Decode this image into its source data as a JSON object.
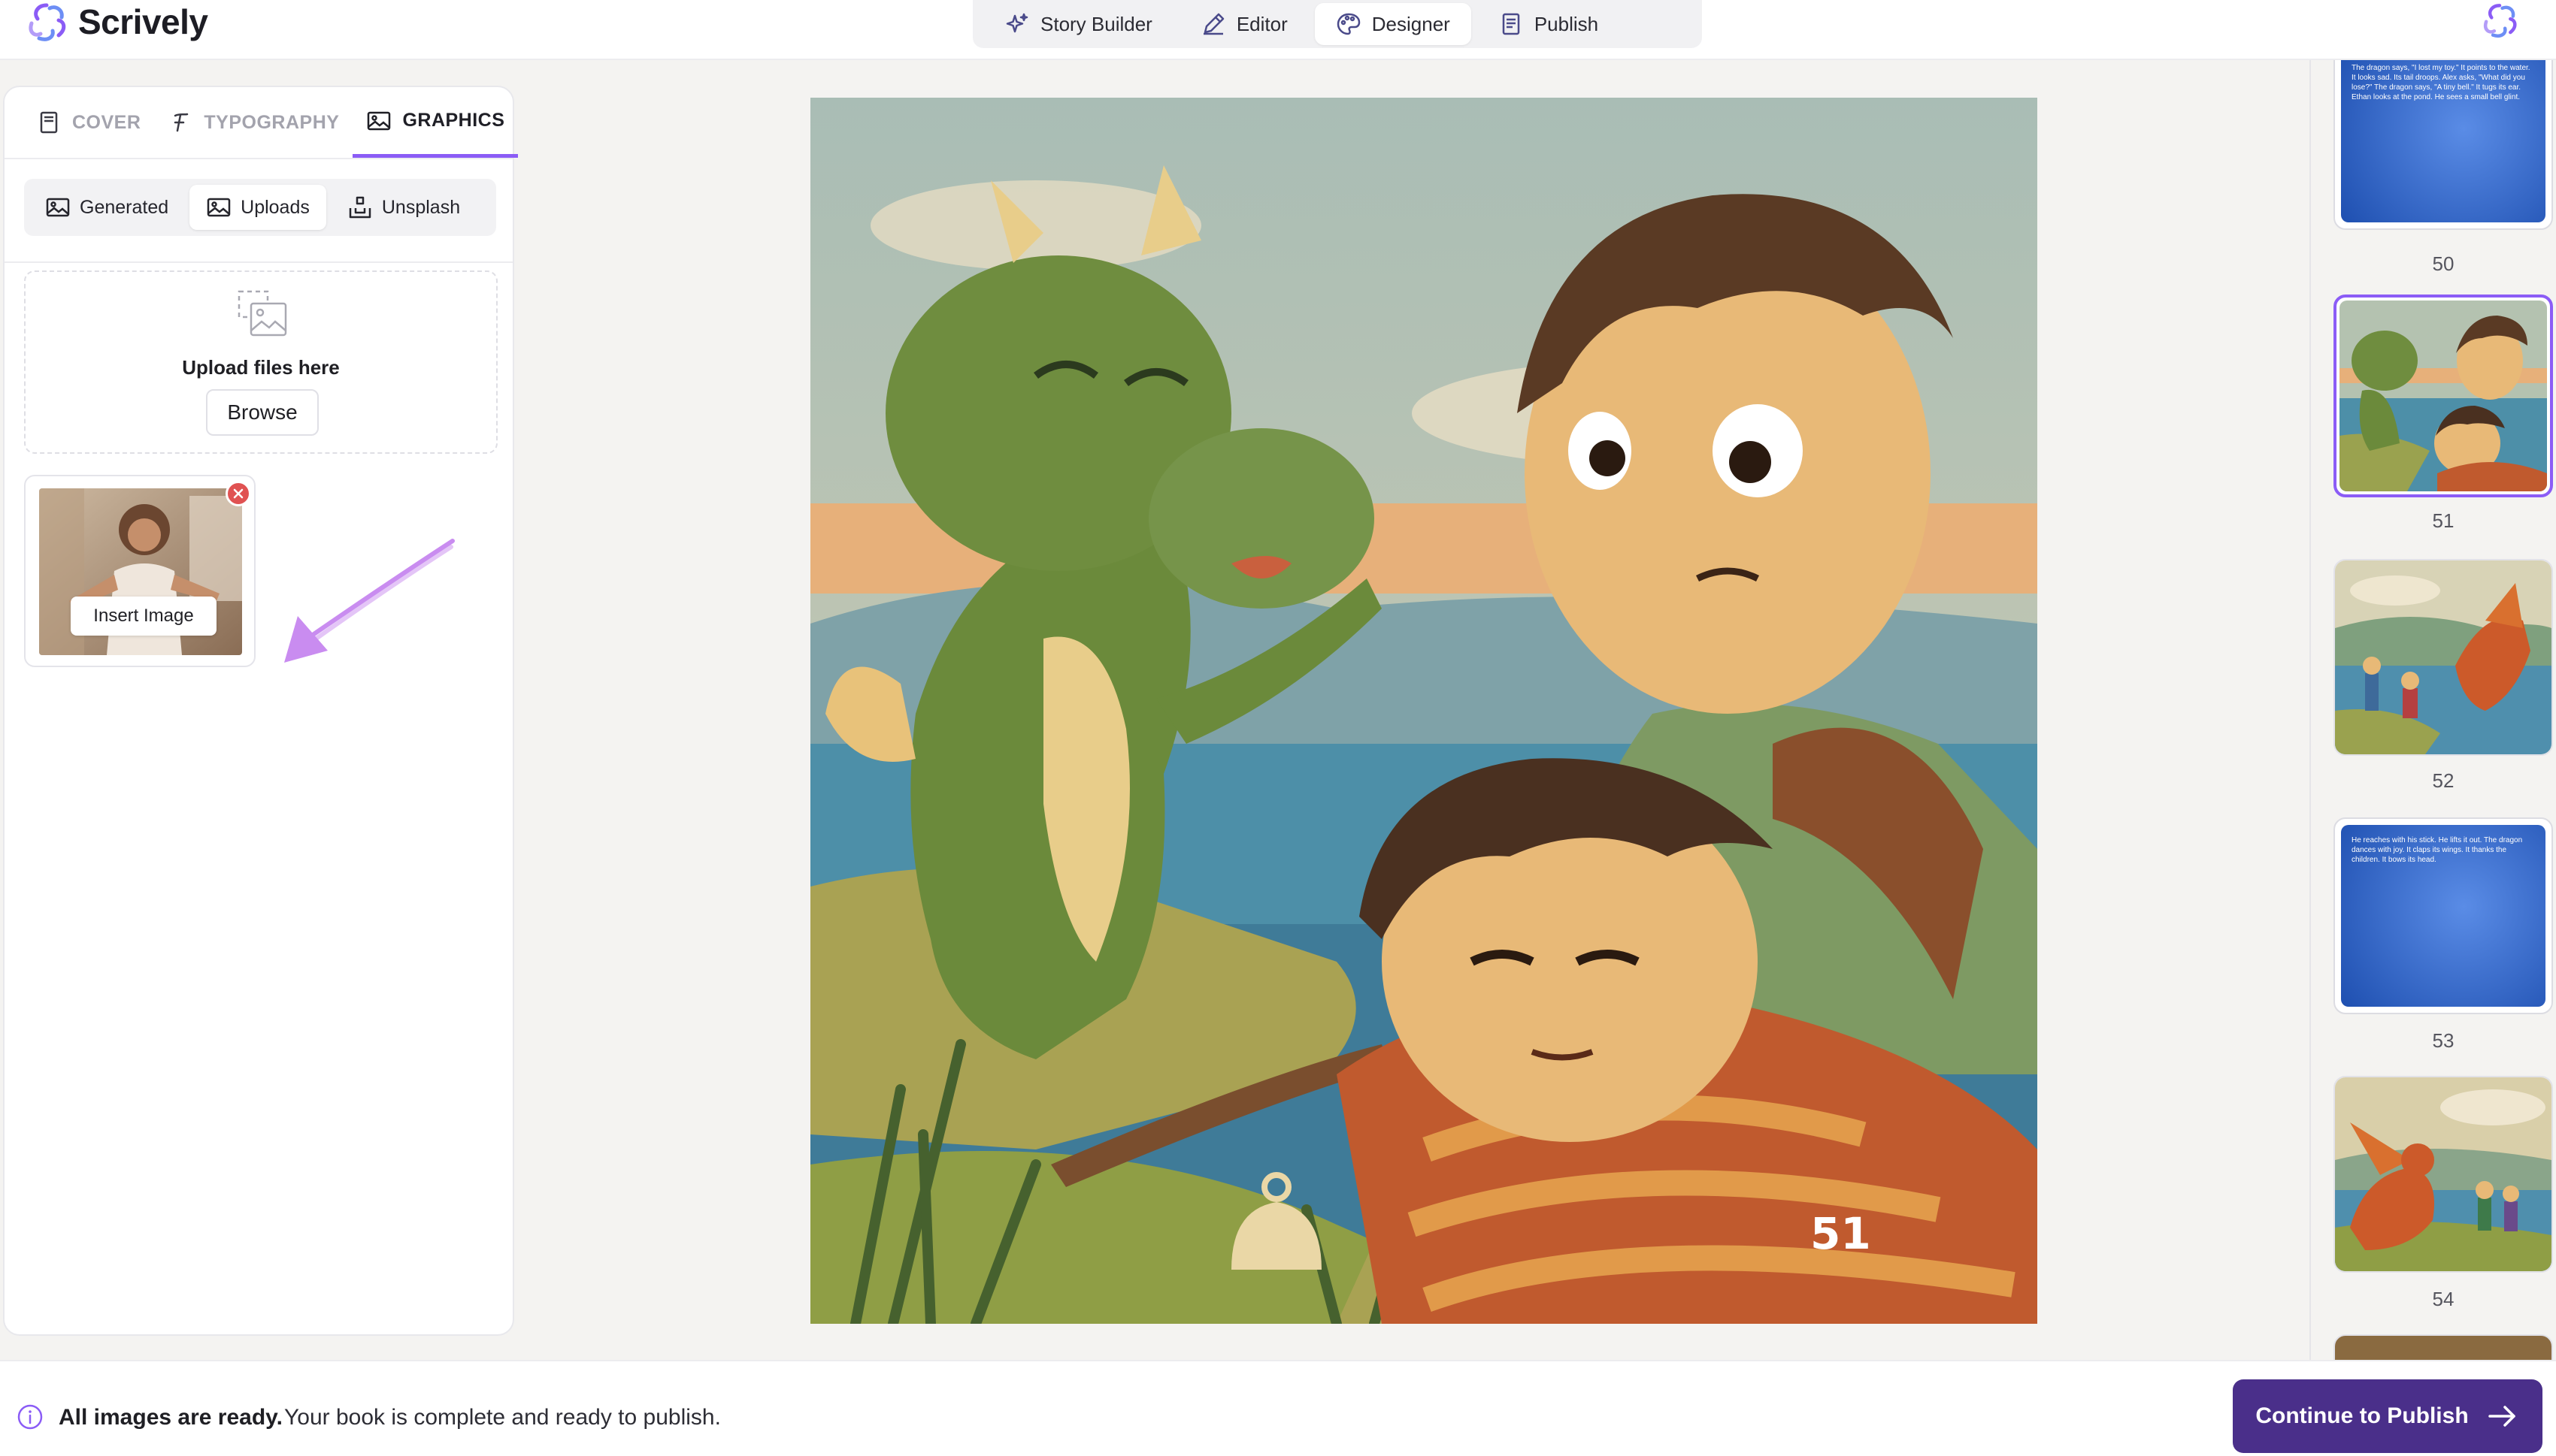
{
  "app": {
    "name": "Scrively",
    "brand_color": "#8b5cf6",
    "primary_button_color": "#4a2f8a"
  },
  "nav": {
    "items": [
      {
        "label": "Story Builder",
        "icon": "sparkles-icon",
        "active": false
      },
      {
        "label": "Editor",
        "icon": "pen-icon",
        "active": false
      },
      {
        "label": "Designer",
        "icon": "palette-icon",
        "active": true
      },
      {
        "label": "Publish",
        "icon": "document-icon",
        "active": false
      }
    ]
  },
  "left_panel": {
    "tabs": [
      {
        "label": "COVER",
        "icon": "book-icon",
        "active": false
      },
      {
        "label": "TYPOGRAPHY",
        "icon": "font-icon",
        "active": false
      },
      {
        "label": "GRAPHICS",
        "icon": "image-icon",
        "active": true
      }
    ],
    "subtabs": [
      {
        "label": "Generated",
        "icon": "image-icon",
        "active": false
      },
      {
        "label": "Uploads",
        "icon": "image-icon",
        "active": true
      },
      {
        "label": "Unsplash",
        "icon": "download-icon",
        "active": false
      }
    ],
    "upload": {
      "prompt": "Upload files here",
      "browse_label": "Browse"
    },
    "uploaded_image": {
      "insert_label": "Insert Image"
    }
  },
  "canvas": {
    "page_number": "51"
  },
  "thumbnails": [
    {
      "number": "50",
      "type": "text",
      "text": "The dragon says, \"I lost my toy.\" It points to the water. It looks sad. Its tail droops. Alex asks, \"What did you lose?\" The dragon says, \"A tiny bell.\" It tugs its ear. Ethan looks at the pond. He sees a small bell glint."
    },
    {
      "number": "51",
      "type": "image",
      "selected": true
    },
    {
      "number": "52",
      "type": "image",
      "selected": false
    },
    {
      "number": "53",
      "type": "text",
      "text": "He reaches with his stick. He lifts it out. The dragon dances with joy. It claps its wings. It thanks the children. It bows its head."
    },
    {
      "number": "54",
      "type": "image",
      "selected": false
    }
  ],
  "status": {
    "bold": "All images are ready.",
    "text": "Your book is complete and ready to publish."
  },
  "actions": {
    "continue_label": "Continue to Publish"
  }
}
